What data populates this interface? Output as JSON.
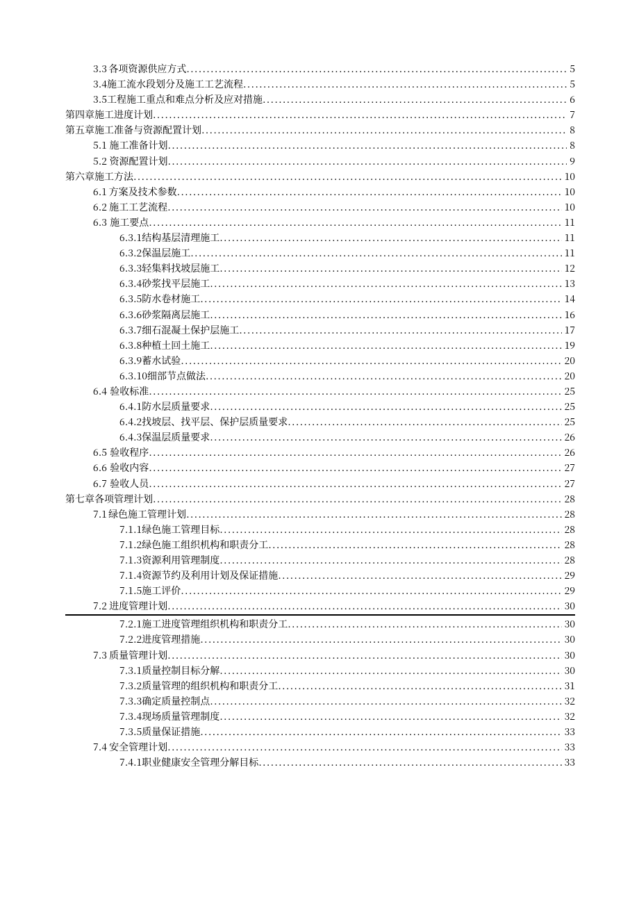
{
  "toc": [
    {
      "level": 1,
      "num": "3.3",
      "title": "各项资源供应方式",
      "page": "5"
    },
    {
      "level": 1,
      "num": "3.4",
      "title": "施工流水段划分及施工工艺流程",
      "page": "5"
    },
    {
      "level": 1,
      "num": "3.5",
      "title": "工程施工重点和难点分析及应对措施",
      "page": "6"
    },
    {
      "level": 0,
      "num": "第四章",
      "title": "施工进度计划",
      "page": "7",
      "chapterSpaced": true
    },
    {
      "level": 0,
      "num": "第五章施工准备与资源配置计划",
      "title": "",
      "page": "8",
      "chapterSpaced": false
    },
    {
      "level": 1,
      "num": "5.1",
      "title": "施工准备计划",
      "page": "8"
    },
    {
      "level": 1,
      "num": "5.2",
      "title": "资源配置计划",
      "page": "9"
    },
    {
      "level": 0,
      "num": "第六章施工方法",
      "title": "",
      "page": "10",
      "chapterSpaced": false
    },
    {
      "level": 1,
      "num": "6.1",
      "title": "方案及技术参数",
      "page": "10"
    },
    {
      "level": 1,
      "num": "6.2",
      "title": "施工工艺流程",
      "page": "10"
    },
    {
      "level": 1,
      "num": "6.3",
      "title": "施工要点",
      "page": "11"
    },
    {
      "level": 2,
      "num": "6.3.1",
      "title": "结构基层清理施工",
      "page": "11"
    },
    {
      "level": 2,
      "num": "6.3.2",
      "title": "保温层施工",
      "page": "11"
    },
    {
      "level": 2,
      "num": "6.3.3",
      "title": "轻集料找坡层施工",
      "page": "12"
    },
    {
      "level": 2,
      "num": "6.3.4",
      "title": "砂浆找平层施工",
      "page": "13"
    },
    {
      "level": 2,
      "num": "6.3.5",
      "title": "防水卷材施工",
      "page": "14"
    },
    {
      "level": 2,
      "num": "6.3.6",
      "title": "砂浆隔离层施工",
      "page": "16"
    },
    {
      "level": 2,
      "num": "6.3.7",
      "title": "细石混凝土保护层施工",
      "page": "17"
    },
    {
      "level": 2,
      "num": "6.3.8",
      "title": "种植土回土施工",
      "page": "19"
    },
    {
      "level": 2,
      "num": "6.3.9",
      "title": "蓄水试验",
      "page": "20"
    },
    {
      "level": 2,
      "num": "6.3.10",
      "title": "细部节点做法",
      "page": "20",
      "wideNum": true
    },
    {
      "level": 1,
      "num": "6.4",
      "title": "验收标准",
      "page": "25"
    },
    {
      "level": 2,
      "num": "6.4.1",
      "title": "防水层质量要求",
      "page": "25"
    },
    {
      "level": 2,
      "num": "6.4.2",
      "title": "找坡层、找平层、保护层质量要求",
      "page": "25"
    },
    {
      "level": 2,
      "num": "6.4.3",
      "title": "保温层质量要求",
      "page": "26"
    },
    {
      "level": 1,
      "num": "6.5",
      "title": "验收程序",
      "page": "26"
    },
    {
      "level": 1,
      "num": "6.6",
      "title": "验收内容",
      "page": "27"
    },
    {
      "level": 1,
      "num": "6.7",
      "title": "验收人员",
      "page": "27"
    },
    {
      "level": 0,
      "num": "第七章各项管理计划",
      "title": "",
      "page": "28",
      "chapterSpaced": false
    },
    {
      "level": 1,
      "num": "7.1",
      "title": "绿色施工管理计划",
      "page": "28"
    },
    {
      "level": 2,
      "num": "7.1.1",
      "title": "绿色施工管理目标",
      "page": "28"
    },
    {
      "level": 2,
      "num": "7.1.2",
      "title": "绿色施工组织机构和职责分工",
      "page": "28"
    },
    {
      "level": 2,
      "num": "7.1.3",
      "title": "资源利用管理制度",
      "page": "28"
    },
    {
      "level": 2,
      "num": "7.1.4",
      "title": "资源节约及利用计划及保证措施",
      "page": "29"
    },
    {
      "level": 2,
      "num": "7.1.5",
      "title": "施工评价",
      "page": "29"
    },
    {
      "level": 1,
      "num": "7.2",
      "title": "进度管理计划",
      "page": "30",
      "dividerAfter": true
    },
    {
      "level": 2,
      "num": "7.2.1",
      "title": "施工进度管理组织机构和职责分工",
      "page": "30"
    },
    {
      "level": 2,
      "num": "7.2.2",
      "title": "进度管理措施",
      "page": "30"
    },
    {
      "level": 1,
      "num": "7.3",
      "title": "质量管理计划",
      "page": "30"
    },
    {
      "level": 2,
      "num": "7.3.1",
      "title": "质量控制目标分解",
      "page": "30"
    },
    {
      "level": 2,
      "num": "7.3.2",
      "title": "质量管理的组织机构和职责分工",
      "page": "31"
    },
    {
      "level": 2,
      "num": "7.3.3",
      "title": "确定质量控制点",
      "page": "32"
    },
    {
      "level": 2,
      "num": "7.3.4",
      "title": "现场质量管理制度",
      "page": "32"
    },
    {
      "level": 2,
      "num": "7.3.5",
      "title": "质量保证措施",
      "page": "33"
    },
    {
      "level": 1,
      "num": "7.4",
      "title": "安全管理计划",
      "page": "33"
    },
    {
      "level": 2,
      "num": "7.4.1",
      "title": "职业健康安全管理分解目标",
      "page": "33"
    }
  ]
}
